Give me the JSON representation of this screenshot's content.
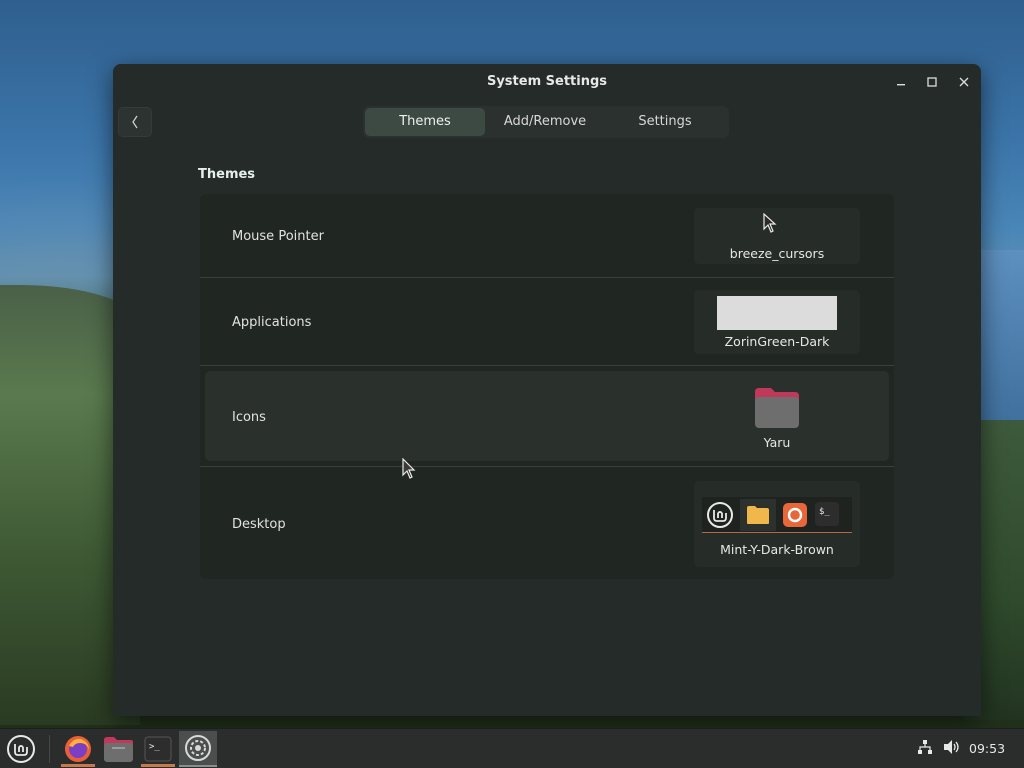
{
  "window": {
    "title": "System Settings"
  },
  "tabs": [
    {
      "label": "Themes",
      "active": true
    },
    {
      "label": "Add/Remove",
      "active": false
    },
    {
      "label": "Settings",
      "active": false
    }
  ],
  "section": {
    "heading": "Themes"
  },
  "themes": {
    "mouse_pointer": {
      "label": "Mouse Pointer",
      "value": "breeze_cursors"
    },
    "applications": {
      "label": "Applications",
      "value": "ZorinGreen-Dark"
    },
    "icons": {
      "label": "Icons",
      "value": "Yaru"
    },
    "desktop": {
      "label": "Desktop",
      "value": "Mint-Y-Dark-Brown"
    }
  },
  "taskbar": {
    "clock": "09:53",
    "launchers": [
      "menu-icon",
      "firefox-icon",
      "files-icon",
      "terminal-icon",
      "settings-icon"
    ]
  },
  "colors": {
    "accent_green": "#3d4a44",
    "window_bg": "#252b28",
    "folder_icon_tab": "#c0395a",
    "taskbar_running_indicator": "#c7784e"
  }
}
